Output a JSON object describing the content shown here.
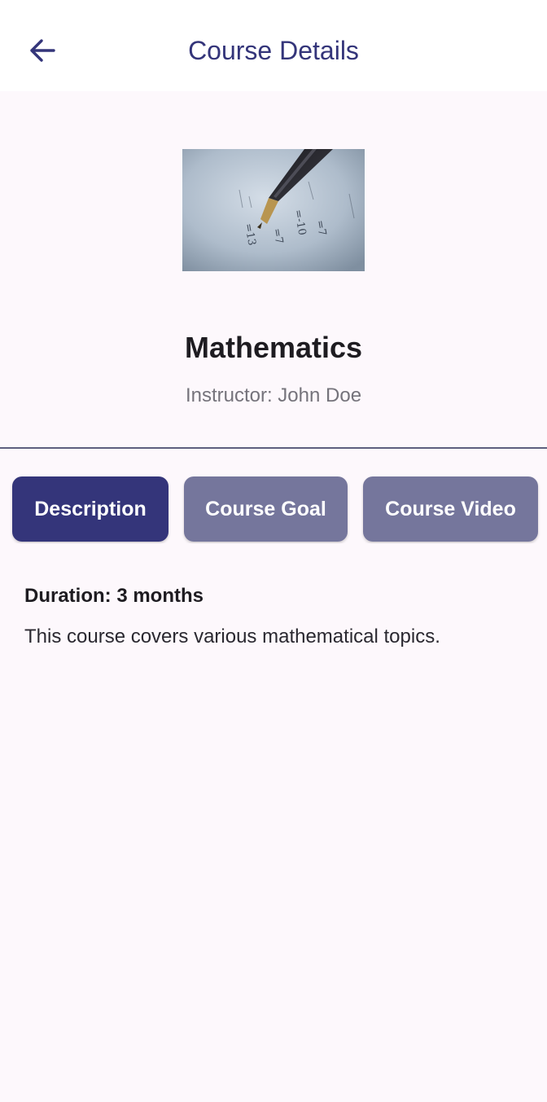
{
  "appbar": {
    "title": "Course Details",
    "back_icon": "arrow-left-icon"
  },
  "course": {
    "image_alt": "pen-on-math-paper",
    "image_text": [
      "=7",
      "=-10",
      "=13",
      "=7"
    ],
    "title": "Mathematics",
    "instructor": "Instructor: John Doe"
  },
  "tabs": [
    {
      "label": "Description",
      "active": true
    },
    {
      "label": "Course Goal",
      "active": false
    },
    {
      "label": "Course Video",
      "active": false
    }
  ],
  "content": {
    "duration": "Duration: 3 months",
    "description": "This course covers various mathematical topics."
  },
  "colors": {
    "primary": "#34357a",
    "tab_inactive": "#75769c",
    "background": "#fdf8fc"
  }
}
